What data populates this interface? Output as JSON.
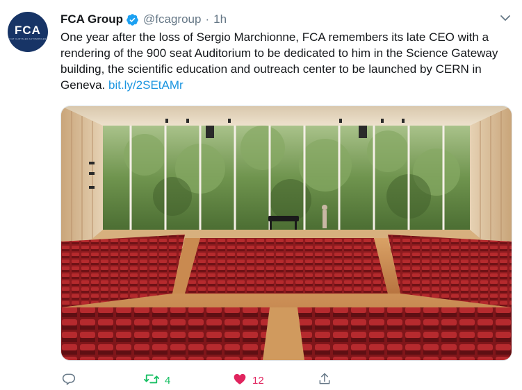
{
  "tweet": {
    "avatar_label": "FCA",
    "avatar_sublabel": "FIAT CHRYSLER AUTOMOBILES",
    "display_name": "FCA Group",
    "handle": "@fcagroup",
    "separator": "·",
    "time": "1h",
    "text": "One year after the loss of Sergio Marchionne, FCA remembers its late CEO with a rendering of the 900 seat Auditorium to be dedicated to him in the Science Gateway building, the scientific education and outreach center to be launched by CERN in Geneva. ",
    "link": "bit.ly/2SEtAMr",
    "verified": true
  },
  "actions": {
    "reply_count": "",
    "retweet_count": "4",
    "like_count": "12"
  },
  "colors": {
    "brand_blue": "#1da1f2",
    "link": "#1b95e0",
    "retweet_green": "#17bf63",
    "like_red": "#e0245e",
    "muted": "#657786"
  },
  "icons": [
    "verified-badge-icon",
    "chevron-down-icon",
    "reply-icon",
    "retweet-icon",
    "heart-icon",
    "share-icon"
  ]
}
